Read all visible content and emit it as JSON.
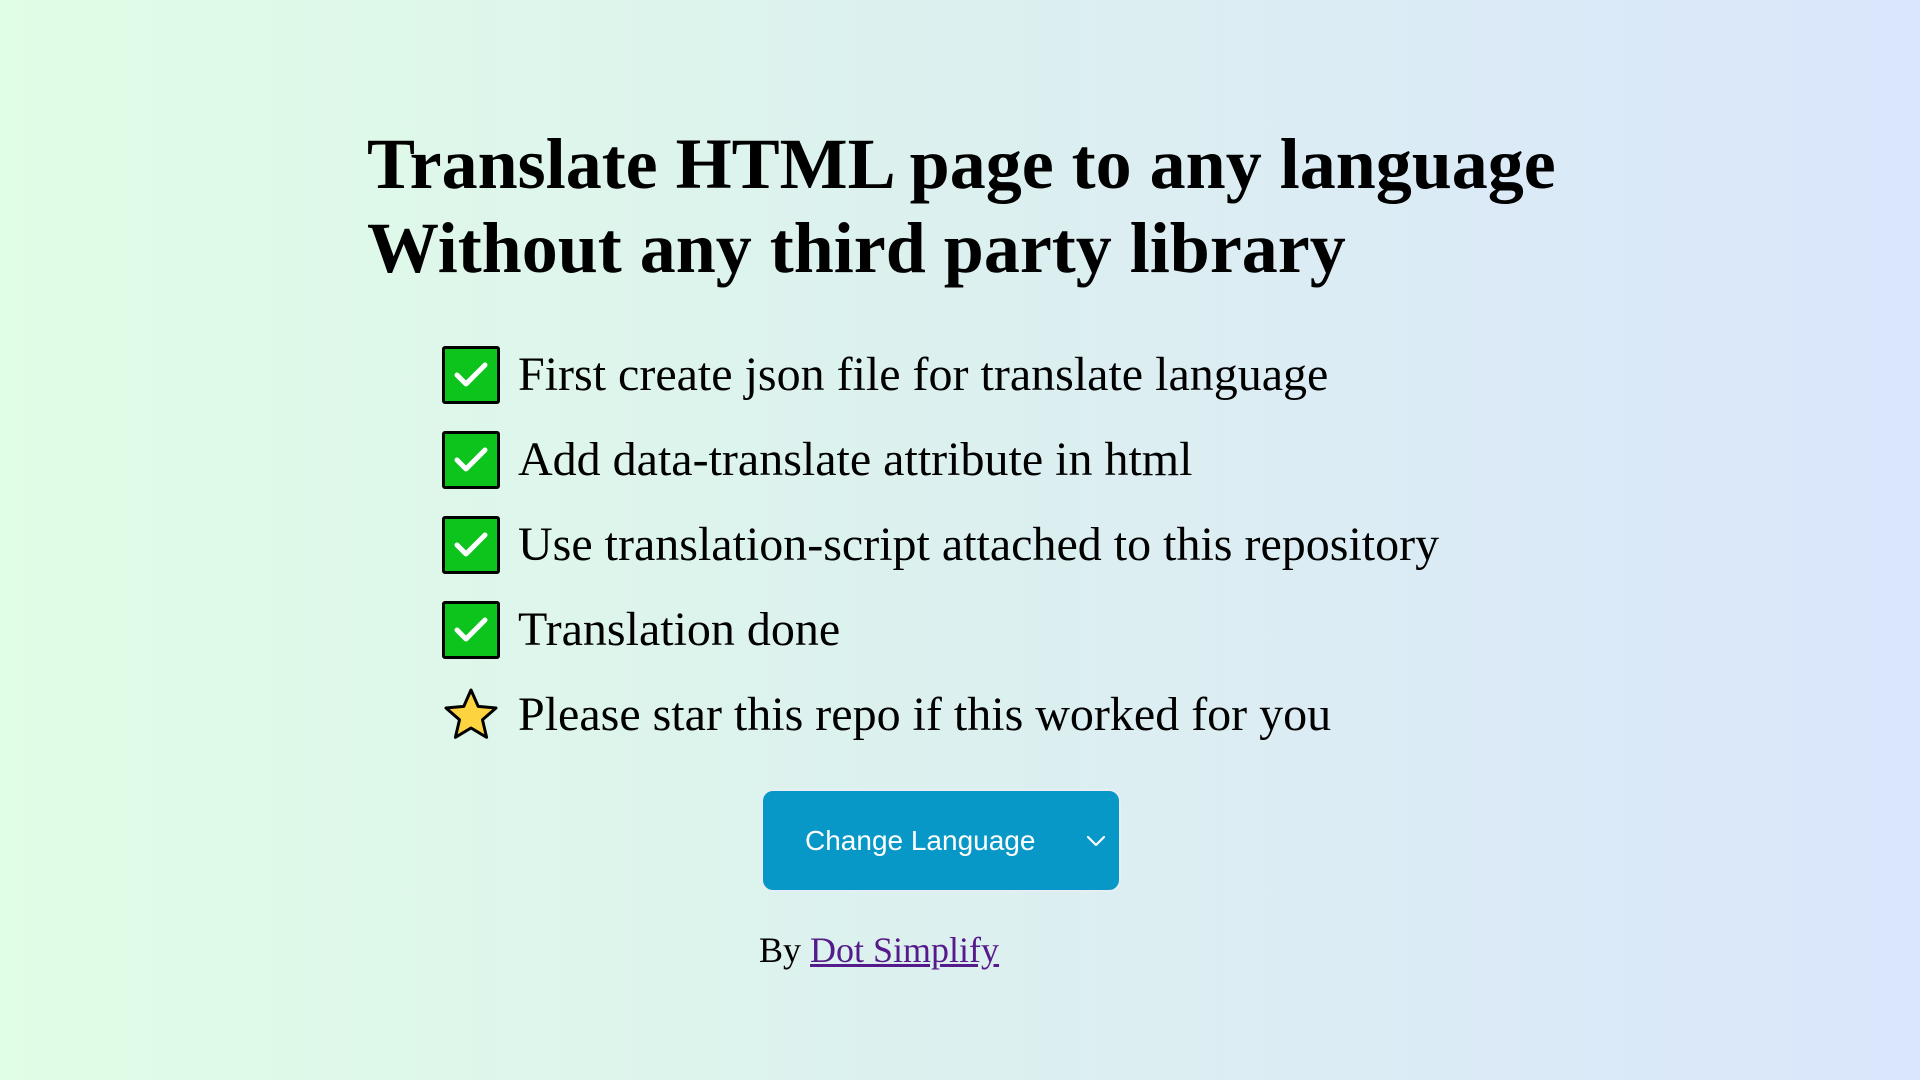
{
  "heading": {
    "line1": "Translate HTML page to any language",
    "line2": "Without any third party library"
  },
  "steps": [
    {
      "icon": "check-box-icon",
      "text": "First create json file for translate language"
    },
    {
      "icon": "check-box-icon",
      "text": "Add data-translate attribute in html"
    },
    {
      "icon": "check-box-icon",
      "text": "Use translation-script attached to this repository"
    },
    {
      "icon": "check-box-icon",
      "text": "Translation done"
    },
    {
      "icon": "star-icon",
      "text": "Please star this repo if this worked for you"
    }
  ],
  "language_select": {
    "label": "Change Language",
    "icon": "chevron-down-icon"
  },
  "byline": {
    "prefix": "By",
    "link_text": "Dot Simplify"
  },
  "colors": {
    "check_green": "#0cc41c",
    "star_yellow": "#fdd33f",
    "button_blue": "#0898c8",
    "link_purple": "#551a8b"
  }
}
